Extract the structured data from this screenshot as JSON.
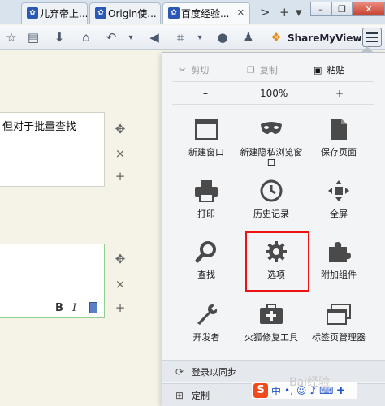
{
  "tabs": [
    {
      "label": "儿弃帝上..."
    },
    {
      "label": "Origin使..."
    },
    {
      "label": "百度经验..."
    }
  ],
  "tab_controls": {
    "next": ">",
    "new_tab": "+",
    "list": "▾"
  },
  "window_controls": {
    "minimize": "–",
    "restore": "❐",
    "close": "✕"
  },
  "toolbar": {
    "share_label": "ShareMyView"
  },
  "page": {
    "box1_text": "但对于批量查找",
    "side_controls": {
      "move": "✥",
      "remove": "×",
      "add": "+"
    },
    "format": {
      "bold": "B",
      "italic": "I"
    }
  },
  "menu": {
    "edit": {
      "cut": "剪切",
      "copy": "复制",
      "paste": "粘贴"
    },
    "zoom": {
      "out": "–",
      "level": "100%",
      "in": "+"
    },
    "items": [
      {
        "label": "新建窗口"
      },
      {
        "label": "新建隐私浏览窗口"
      },
      {
        "label": "保存页面"
      },
      {
        "label": "打印"
      },
      {
        "label": "历史记录"
      },
      {
        "label": "全屏"
      },
      {
        "label": "查找"
      },
      {
        "label": "选项"
      },
      {
        "label": "附加组件"
      },
      {
        "label": "开发者"
      },
      {
        "label": "火狐修复工具"
      },
      {
        "label": "标签页管理器"
      }
    ],
    "sync_label": "登录以同步",
    "customize_label": "定制"
  },
  "ime": {
    "logo": "S",
    "mode": "中"
  },
  "watermark": "Bai经验"
}
